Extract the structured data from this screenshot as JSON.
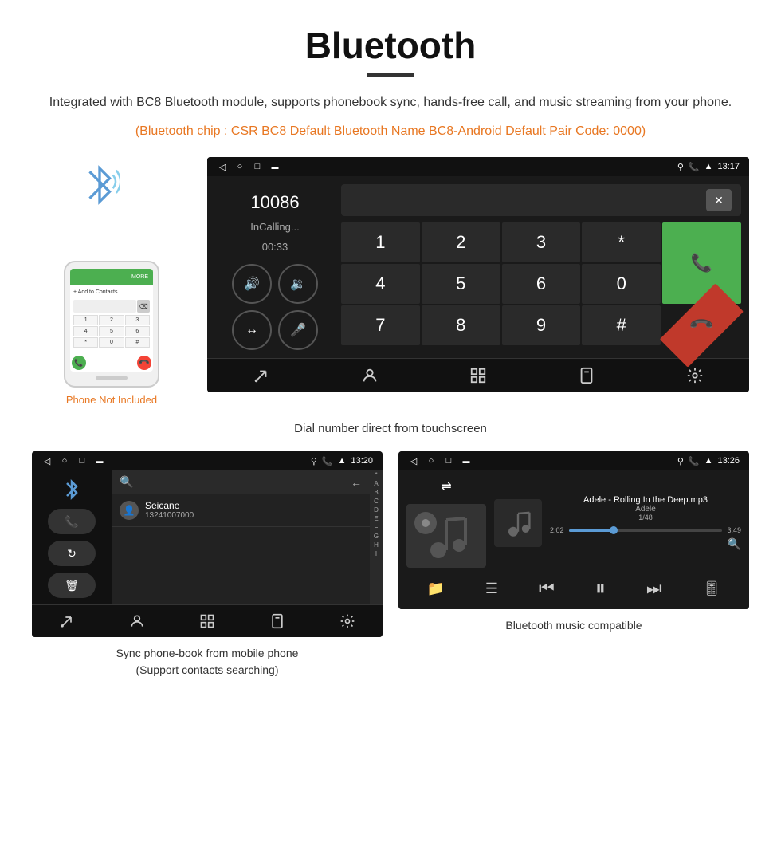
{
  "page": {
    "title": "Bluetooth",
    "title_underline": true,
    "description": "Integrated with BC8 Bluetooth module, supports phonebook sync, hands-free call, and music streaming from your phone.",
    "orange_info": "(Bluetooth chip : CSR BC8    Default Bluetooth Name BC8-Android    Default Pair Code: 0000)",
    "phone_not_included": "Phone Not Included"
  },
  "dial_screen": {
    "status_bar": {
      "left_icons": [
        "back",
        "circle",
        "square",
        "notification"
      ],
      "right_icons": [
        "location",
        "phone",
        "wifi",
        "signal"
      ],
      "time": "13:17"
    },
    "call_number": "10086",
    "call_status": "InCalling...",
    "call_timer": "00:33",
    "keypad": {
      "keys": [
        "1",
        "2",
        "3",
        "*",
        "4",
        "5",
        "6",
        "0",
        "7",
        "8",
        "9",
        "#"
      ],
      "green_btn": "📞",
      "red_btn": "📞"
    },
    "bottom_nav": [
      "call-transfer",
      "contacts",
      "grid",
      "phone-out",
      "settings"
    ]
  },
  "dial_caption": "Dial number direct from touchscreen",
  "phonebook_screen": {
    "status_bar": {
      "time": "13:20"
    },
    "sidebar_icons": [
      "bluetooth",
      "phone",
      "refresh",
      "trash"
    ],
    "search_placeholder": "",
    "contact": {
      "name": "Seicane",
      "phone": "13241007000"
    },
    "alphabet": [
      "*",
      "A",
      "B",
      "C",
      "D",
      "E",
      "F",
      "G",
      "H",
      "I"
    ],
    "bottom_nav": [
      "call",
      "contacts",
      "grid",
      "phone-out",
      "settings"
    ]
  },
  "phonebook_caption": "Sync phone-book from mobile phone\n(Support contacts searching)",
  "music_screen": {
    "status_bar": {
      "time": "13:26"
    },
    "song_title": "Adele - Rolling In the Deep.mp3",
    "artist": "Adele",
    "track_info": "1/48",
    "time_current": "2:02",
    "time_total": "3:49",
    "progress_percent": 30,
    "controls": [
      "shuffle",
      "folder",
      "list",
      "prev",
      "play",
      "next",
      "eq"
    ]
  },
  "music_caption": "Bluetooth music compatible",
  "icons": {
    "bluetooth": "✳",
    "phone": "📞",
    "music": "♪",
    "search": "🔍",
    "settings": "⚙",
    "wifi": "📶",
    "signal": "📶",
    "back_arrow": "◁",
    "circle": "○",
    "square": "□"
  }
}
